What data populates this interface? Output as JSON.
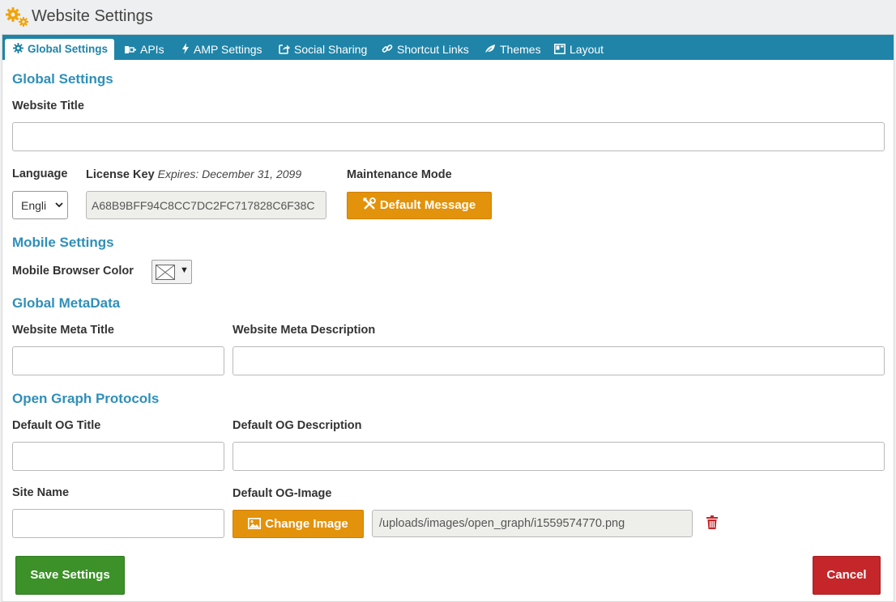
{
  "window": {
    "title": "Website Settings"
  },
  "tabs": [
    {
      "label": "Global Settings",
      "icon": "gear-icon",
      "active": true
    },
    {
      "label": "APIs",
      "icon": "plug-icon"
    },
    {
      "label": "AMP Settings",
      "icon": "bolt-icon"
    },
    {
      "label": "Social Sharing",
      "icon": "share-icon"
    },
    {
      "label": "Shortcut Links",
      "icon": "link-icon"
    },
    {
      "label": "Themes",
      "icon": "leaf-icon"
    },
    {
      "label": "Layout",
      "icon": "layout-icon"
    }
  ],
  "global": {
    "heading": "Global Settings",
    "website_title_label": "Website Title",
    "website_title_value": "",
    "language_label": "Language",
    "language_value": "Engli",
    "license_label": "License Key",
    "license_expiry": "Expires: December 31, 2099",
    "license_value": "A68B9BFF94C8CC7DC2FC717828C6F38C",
    "maintenance_label": "Maintenance Mode",
    "default_message_button": "Default Message"
  },
  "mobile": {
    "heading": "Mobile Settings",
    "browser_color_label": "Mobile Browser Color",
    "browser_color_arrow": "▼"
  },
  "metadata": {
    "heading": "Global MetaData",
    "meta_title_label": "Website Meta Title",
    "meta_title_value": "",
    "meta_description_label": "Website Meta Description",
    "meta_description_value": ""
  },
  "opengraph": {
    "heading": "Open Graph Protocols",
    "og_title_label": "Default OG Title",
    "og_title_value": "",
    "og_description_label": "Default OG Description",
    "og_description_value": "",
    "site_name_label": "Site Name",
    "site_name_value": "",
    "og_image_label": "Default OG-Image",
    "change_image_button": "Change Image",
    "og_image_path": "/uploads/images/open_graph/i1559574770.png"
  },
  "actions": {
    "save_label": "Save Settings",
    "cancel_label": "Cancel"
  },
  "colors": {
    "tab_bar": "#1f84a8",
    "section_heading": "#2f8fb8",
    "orange_button": "#e3920b",
    "save_button": "#3c9128",
    "cancel_button": "#c4262a",
    "trash_icon": "#c4262a",
    "gear_icon": "#f0a30a"
  }
}
